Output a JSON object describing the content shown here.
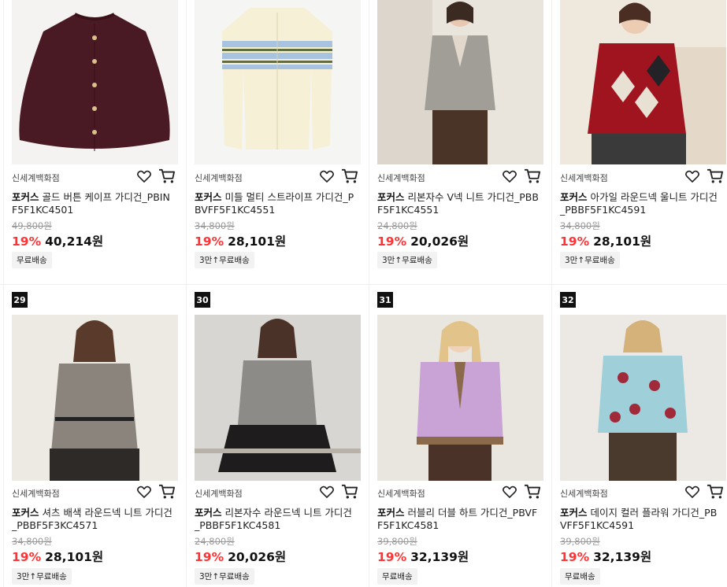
{
  "products": [
    {
      "rank": "",
      "store": "신세계백화점",
      "brand": "포커스",
      "name": "골드 버튼 케이프 가디건_PBINF5F1KC4501",
      "original_price": "49,800원",
      "discount": "19%",
      "price": "40,214원",
      "badge": "무료배송",
      "image": "burgundy-cape-cardigan"
    },
    {
      "rank": "",
      "store": "신세계백화점",
      "brand": "포커스",
      "name": "미들 멀티 스트라이프 가디건_PBVFF5F1KC4551",
      "original_price": "34,800원",
      "discount": "19%",
      "price": "28,101원",
      "badge": "3만↑무료배송",
      "image": "cream-striped-cardigan"
    },
    {
      "rank": "",
      "store": "신세계백화점",
      "brand": "포커스",
      "name": "리본자수 V넥 니트 가디건_PBBF5F1KC4551",
      "original_price": "24,800원",
      "discount": "19%",
      "price": "20,026원",
      "badge": "3만↑무료배송",
      "image": "grey-vneck-cardigan"
    },
    {
      "rank": "",
      "store": "신세계백화점",
      "brand": "포커스",
      "name": "아가일 라운드넥 울니트 가디건_PBBF5F1KC4591",
      "original_price": "34,800원",
      "discount": "19%",
      "price": "28,101원",
      "badge": "3만↑무료배송",
      "image": "red-argyle-cardigan"
    },
    {
      "rank": "29",
      "store": "신세계백화점",
      "brand": "포커스",
      "name": "셔츠 배색 라운드넥 니트 가디건_PBBF5F3KC4571",
      "original_price": "34,800원",
      "discount": "19%",
      "price": "28,101원",
      "badge": "3만↑무료배송",
      "image": "grey-shirt-cardigan"
    },
    {
      "rank": "30",
      "store": "신세계백화점",
      "brand": "포커스",
      "name": "리본자수 라운드넥 니트 가디건_PBBF5F1KC4581",
      "original_price": "24,800원",
      "discount": "19%",
      "price": "20,026원",
      "badge": "3만↑무료배송",
      "image": "grey-ribbon-cardigan"
    },
    {
      "rank": "31",
      "store": "신세계백화점",
      "brand": "포커스",
      "name": "러블리 더블 하트 가디건_PBVFF5F1KC4581",
      "original_price": "39,800원",
      "discount": "19%",
      "price": "32,139원",
      "badge": "무료배송",
      "image": "purple-heart-cardigan"
    },
    {
      "rank": "32",
      "store": "신세계백화점",
      "brand": "포커스",
      "name": "데이지 컬러 플라워 가디건_PBVFF5F1KC4591",
      "original_price": "39,800원",
      "discount": "19%",
      "price": "32,139원",
      "badge": "무료배송",
      "image": "blue-daisy-cardigan"
    }
  ],
  "colors": {
    "discount": "#ff3333",
    "rank_bg": "#111111",
    "badge_bg": "#f2f2f2"
  },
  "icons": {
    "wishlist": "heart-icon",
    "cart": "cart-icon"
  }
}
